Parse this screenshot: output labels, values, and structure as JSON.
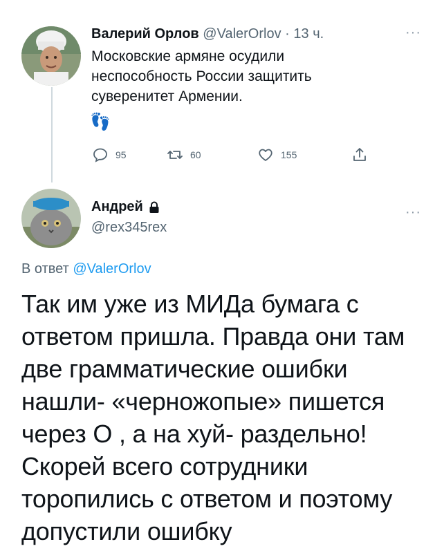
{
  "parent": {
    "author_name": "Валерий Орлов",
    "handle": "@ValerOrlov",
    "separator": "·",
    "time": "13 ч.",
    "more": "···",
    "text": "Московские армяне осудили неспособность России защитить суверенитет Армении.",
    "emoji": "👣",
    "actions": {
      "reply_count": "95",
      "retweet_count": "60",
      "like_count": "155"
    }
  },
  "reply": {
    "author_name": "Андрей",
    "lock_emoji": "🔒",
    "handle": "@rex345rex",
    "more": "···",
    "reply_to_prefix": "В ответ",
    "reply_to_handle": "@ValerOrlov",
    "text": "Так им уже из МИДа бумага с ответом пришла. Правда они там две грамматические ошибки нашли- «черножопые» пишется через О , а на хуй- раздельно! Скорей всего сотрудники торопились с ответом и поэтому допустили ошибку"
  },
  "icons": {
    "reply": "speech-bubble-icon",
    "retweet": "retweet-icon",
    "like": "heart-icon",
    "share": "share-icon",
    "lock": "lock-icon"
  },
  "colors": {
    "link": "#1d9bf0",
    "secondary_text": "#536471",
    "thread_line": "#cfd9de"
  }
}
